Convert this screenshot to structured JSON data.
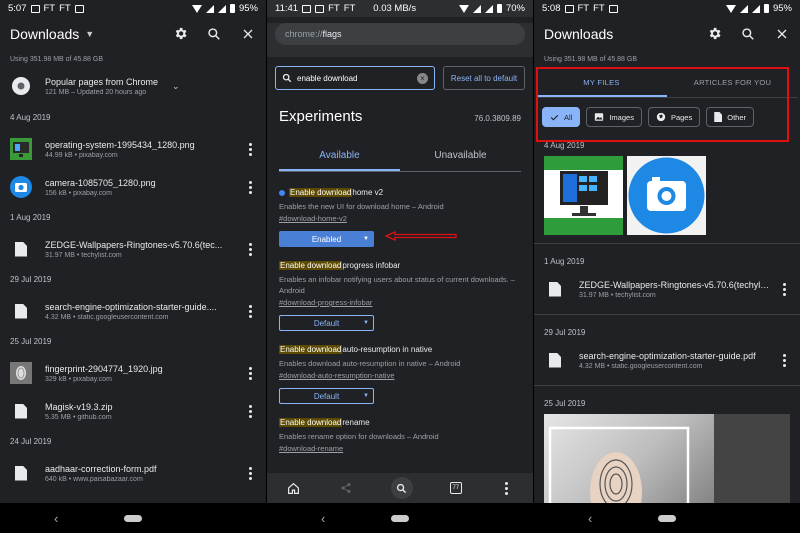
{
  "panel1": {
    "status": {
      "time": "5:07",
      "carrier_a": "FT",
      "carrier_b": "FT",
      "battery": "95%"
    },
    "title": "Downloads",
    "usage": "Using 351.98 MB of 45.88 GB",
    "popular": {
      "name": "Popular pages from Chrome",
      "meta": "121 MB – Updated 20 hours ago"
    },
    "groups": [
      {
        "date": "4 Aug 2019",
        "items": [
          {
            "name": "operating-system-1995434_1280.png",
            "meta": "44.99 kB • pixabay.com",
            "icon": "image-thumbnail"
          },
          {
            "name": "camera-1085705_1280.png",
            "meta": "156 kB • pixabay.com",
            "icon": "camera-thumbnail"
          }
        ]
      },
      {
        "date": "1 Aug 2019",
        "items": [
          {
            "name": "ZEDGE-Wallpapers-Ringtones-v5.70.6(tec...",
            "meta": "31.97 MB • techylist.com",
            "icon": "file-icon"
          }
        ]
      },
      {
        "date": "29 Jul 2019",
        "items": [
          {
            "name": "search-engine-optimization-starter-guide....",
            "meta": "4.32 MB • static.googleusercontent.com",
            "icon": "file-icon"
          }
        ]
      },
      {
        "date": "25 Jul 2019",
        "items": [
          {
            "name": "fingerprint-2904774_1920.jpg",
            "meta": "329 kB • pixabay.com",
            "icon": "fingerprint-thumbnail"
          },
          {
            "name": "Magisk-v19.3.zip",
            "meta": "5.35 MB • github.com",
            "icon": "file-icon"
          }
        ]
      },
      {
        "date": "24 Jul 2019",
        "items": [
          {
            "name": "aadhaar-correction-form.pdf",
            "meta": "640 kB • www.paisabazaar.com",
            "icon": "file-icon"
          }
        ]
      }
    ]
  },
  "panel2": {
    "status": {
      "time": "11:41",
      "carrier_a": "FT",
      "carrier_b": "FT",
      "speed": "0.03 MB/s",
      "battery": "70%"
    },
    "url_scheme": "chrome://",
    "url_host": "flags",
    "search_value": "enable download",
    "reset_label": "Reset all to default",
    "heading": "Experiments",
    "version": "76.0.3809.89",
    "tab_available": "Available",
    "tab_unavailable": "Unavailable",
    "flags": [
      {
        "hl": "Enable download",
        "rest": " home v2",
        "desc": "Enables the new UI for download home – Android",
        "link": "#download-home-v2",
        "value": "Enabled"
      },
      {
        "hl": "Enable download",
        "rest": " progress infobar",
        "desc": "Enables an infobar notifying users about status of current downloads. – Android",
        "link": "#download-progress-infobar",
        "value": "Default"
      },
      {
        "hl": "Enable download",
        "rest": " auto-resumption in native",
        "desc": "Enables download auto-resumption in native – Android",
        "link": "#download-auto-resumption-native",
        "value": "Default"
      },
      {
        "hl": "Enable download",
        "rest": " rename",
        "desc": "Enables rename option for downloads – Android",
        "link": "#download-rename"
      }
    ],
    "tab_count": "77"
  },
  "panel3": {
    "status": {
      "time": "5:08",
      "carrier_a": "FT",
      "carrier_b": "FT",
      "battery": "95%"
    },
    "title": "Downloads",
    "usage": "Using 351.98 MB of 45.88 GB",
    "tab_files": "MY FILES",
    "tab_articles": "ARTICLES FOR YOU",
    "chips": {
      "all": "All",
      "images": "Images",
      "pages": "Pages",
      "other": "Other"
    },
    "date1": "4 Aug 2019",
    "date2": "1 Aug 2019",
    "file1": {
      "name": "ZEDGE-Wallpapers-Ringtones-v5.70.6(techylis...",
      "meta": "31.97 MB • techylist.com"
    },
    "date3": "29 Jul 2019",
    "file2": {
      "name": "search-engine-optimization-starter-guide.pdf",
      "meta": "4.32 MB • static.googleusercontent.com"
    },
    "date4": "25 Jul 2019"
  }
}
